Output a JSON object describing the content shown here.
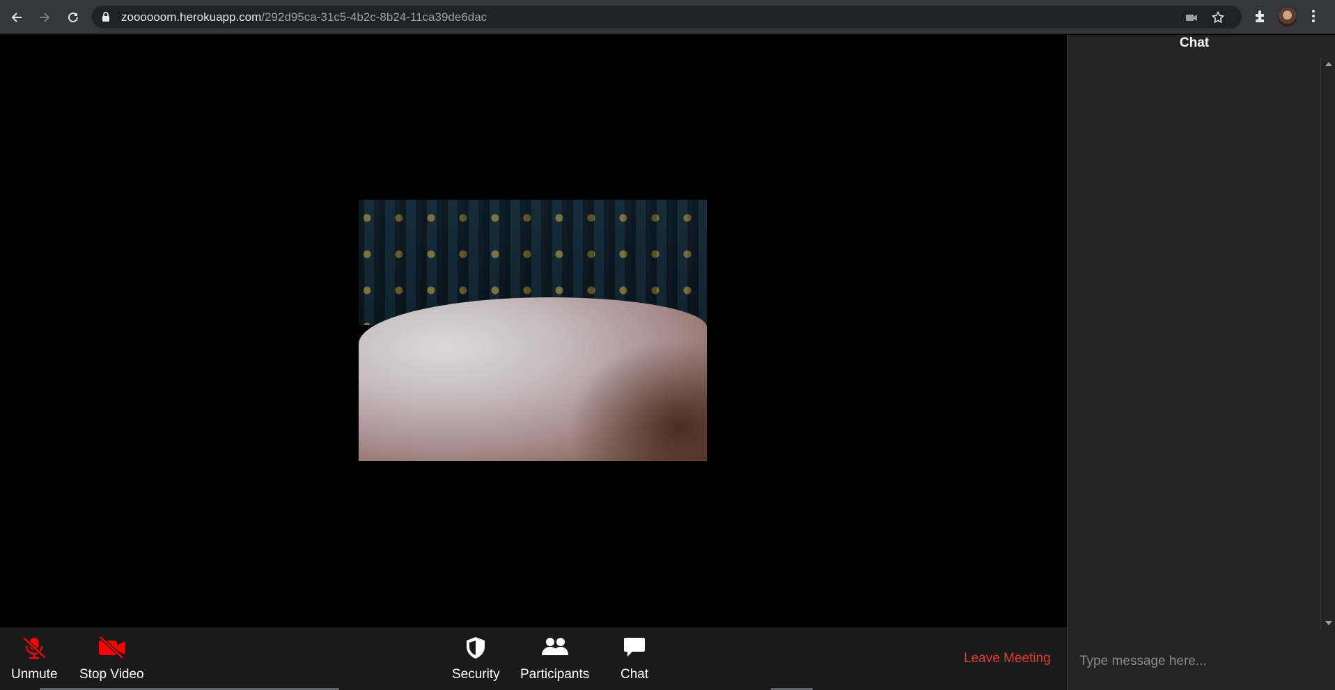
{
  "browser": {
    "url_domain": "zoooooom.herokuapp.com",
    "url_path": "/292d95ca-31c5-4b2c-8b24-11ca39de6dac",
    "icons": [
      "back-arrow-icon",
      "forward-arrow-icon",
      "reload-icon",
      "lock-icon",
      "camera-icon",
      "star-icon",
      "extensions-icon",
      "profile-avatar",
      "more-vert-icon"
    ]
  },
  "toolbar": {
    "unmute_label": "Unmute",
    "stop_video_label": "Stop Video",
    "security_label": "Security",
    "participants_label": "Participants",
    "chat_label": "Chat",
    "leave_label": "Leave Meeting"
  },
  "chat": {
    "title": "Chat",
    "input_placeholder": "Type message here..."
  },
  "colors": {
    "danger": "#e53935",
    "muted_icon": "#ff0000",
    "panel_bg": "#242424",
    "toolbar_bg": "#1a1a1a"
  }
}
